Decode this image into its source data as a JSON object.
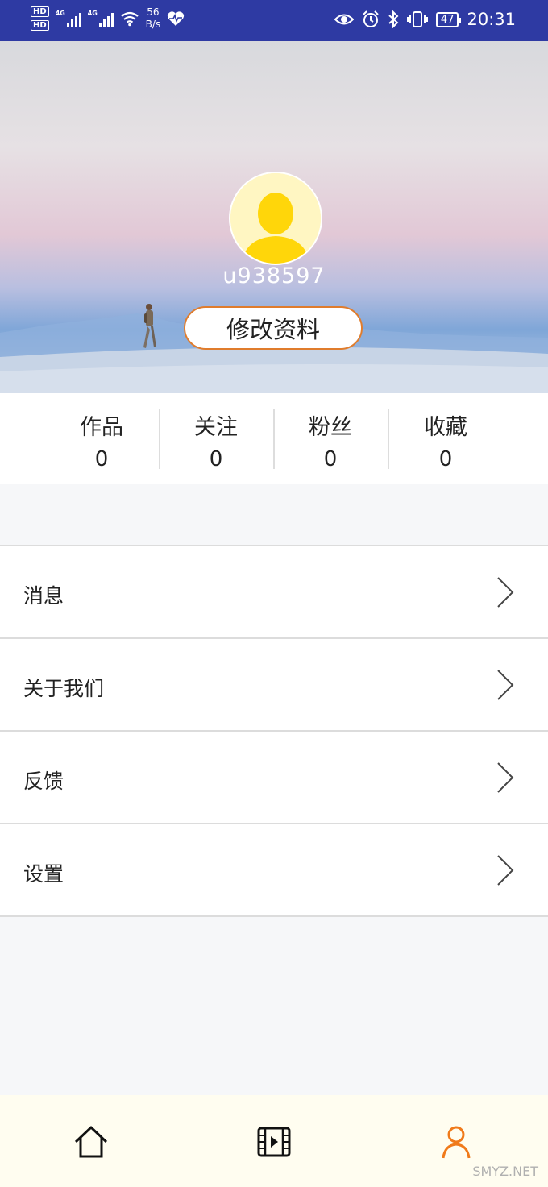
{
  "status_bar": {
    "hd1": "HD",
    "hd2": "HD",
    "net1": "4G",
    "net2": "4G",
    "speed_value": "56",
    "speed_unit": "B/s",
    "battery": "47",
    "time": "20:31",
    "icons": [
      "hd-icon",
      "signal-icon",
      "wifi-icon",
      "heart-rate-icon",
      "eye-icon",
      "alarm-icon",
      "bluetooth-icon",
      "vibrate-icon",
      "battery-icon"
    ]
  },
  "profile": {
    "username": "u938597",
    "edit_label": "修改资料"
  },
  "stats": [
    {
      "label": "作品",
      "value": "0"
    },
    {
      "label": "关注",
      "value": "0"
    },
    {
      "label": "粉丝",
      "value": "0"
    },
    {
      "label": "收藏",
      "value": "0"
    }
  ],
  "menu": [
    {
      "label": "消息"
    },
    {
      "label": "关于我们"
    },
    {
      "label": "反馈"
    },
    {
      "label": "设置"
    }
  ],
  "bottom_nav": [
    {
      "icon": "home-icon",
      "active": false
    },
    {
      "icon": "video-icon",
      "active": false
    },
    {
      "icon": "profile-icon",
      "active": true
    }
  ],
  "watermark": "SMYZ.NET",
  "colors": {
    "status_bar": "#2e3aa3",
    "accent": "#e07c2c",
    "page_bg": "#f6f7f9",
    "nav_bg": "#fffdf0",
    "avatar": "#ffd60a"
  }
}
